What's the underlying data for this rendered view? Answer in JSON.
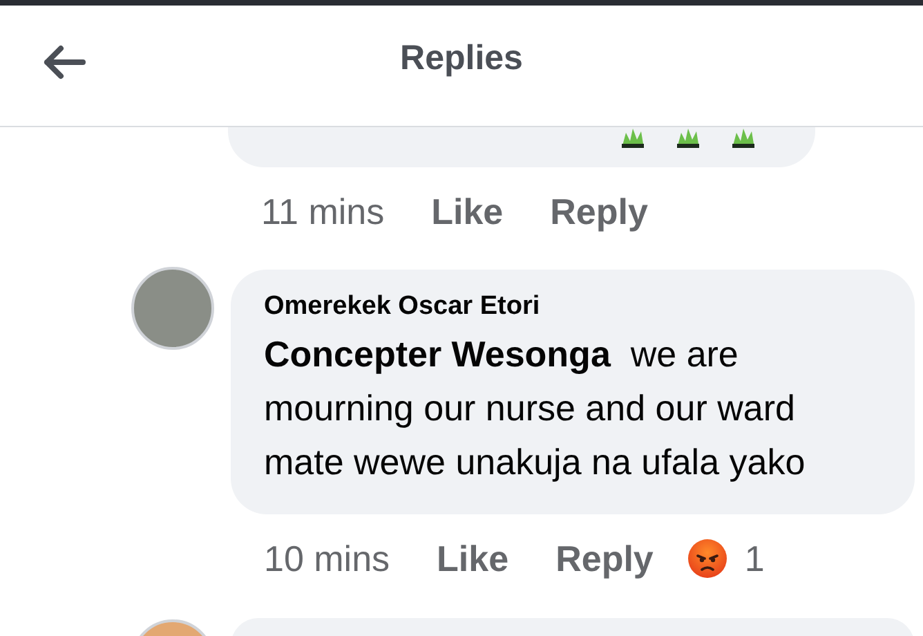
{
  "header": {
    "title": "Replies"
  },
  "comments": [
    {
      "kind": "cutoff",
      "time": "11 mins",
      "actions": [
        "Like",
        "Reply"
      ]
    },
    {
      "kind": "full",
      "author": "Omerekek Oscar Etori",
      "mention": "Concepter Wesonga",
      "text": "we are mourning our nurse and our ward mate wewe unakuja na ufala yako",
      "time": "10 mins",
      "actions": [
        "Like",
        "Reply"
      ],
      "reaction_count": "1"
    },
    {
      "kind": "stub"
    }
  ]
}
